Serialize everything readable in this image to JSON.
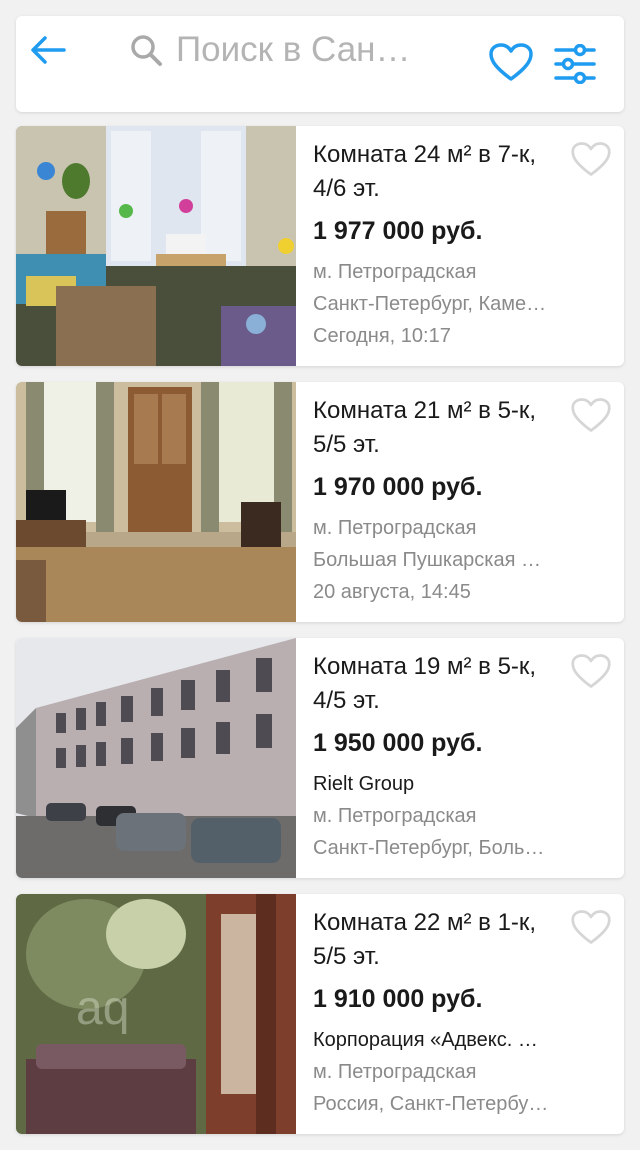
{
  "header": {
    "search_placeholder": "Поиск в Сан…",
    "back_icon": "arrow-left-icon",
    "favorites_icon": "heart-icon",
    "filter_icon": "sliders-icon",
    "accent_color": "#1f9bf0"
  },
  "listings": [
    {
      "title": "Комната 24 м² в 7-к, 4/6 эт.",
      "price": "1 977 000 руб.",
      "line1": "м. Петроградская",
      "line2": "Санкт-Петербург, Каме…",
      "line3": "Сегодня, 10:17",
      "photo": "room-with-balloons-photo"
    },
    {
      "title": "Комната 21 м² в 5-к, 5/5 эт.",
      "price": "1 970 000 руб.",
      "line1": "м. Петроградская",
      "line2": "Большая Пушкарская …",
      "line3": "20 августа, 14:45",
      "photo": "room-with-cabinet-photo"
    },
    {
      "title": "Комната 19 м² в 5-к, 4/5 эт.",
      "price": "1 950 000 руб.",
      "line1": "Rielt Group",
      "line2": "м. Петроградская",
      "line3": "Санкт-Петербург, Боль…",
      "photo": "building-street-photo"
    },
    {
      "title": "Комната 22 м² в 1-к, 5/5 эт.",
      "price": "1 910 000 руб.",
      "line1": "Корпорация «Адвекс. …",
      "line2": "м. Петроградская",
      "line3": "Россия, Санкт-Петербу…",
      "photo": "room-with-sofa-photo"
    }
  ]
}
